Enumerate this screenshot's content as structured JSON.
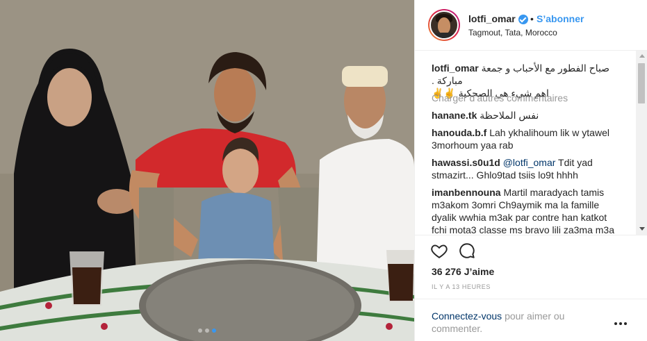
{
  "post": {
    "carousel_dots": 3,
    "active_dot": 2
  },
  "header": {
    "username": "lotfi_omar",
    "separator": "•",
    "follow_label": "S’abonner",
    "location": "Tagmout, Tata, Morocco"
  },
  "caption": {
    "username": "lotfi_omar",
    "text_line1": "صباح الفطور مع الأحباب و جمعة مباركة .",
    "text_line2": "اهم شيء هي الصحكية ✌️✌️"
  },
  "load_more": "Charger d’autres commentaires",
  "comments": [
    {
      "username": "hanane.tk",
      "text": "نفس الملاحظة"
    },
    {
      "username": "hanouda.b.f",
      "text": "Lah ykhalihoum lik w ytawel",
      "text2": "3morhoum yaa rab"
    },
    {
      "username": "hawassi.s0u1d",
      "mention": "@lotfi_omar",
      "text": "Tdit yad",
      "text2": "stmazirt... Ghlo9tad tsiis lo9t hhhh"
    },
    {
      "username": "imanbennouna",
      "text": "Martil maradyach tamis",
      "text2": "m3akom 3omri Ch9aymik ma la famille",
      "text3": "dyalik wwhia m3ak par contre han katkot",
      "text4": "fchi mota3 classe ms bravo lili za3ma m3a"
    }
  ],
  "likes": "36 276 J’aime",
  "timestamp": "IL Y A 13 HEURES",
  "login": {
    "link": "Connectez-vous",
    "text": "pour aimer ou commenter."
  },
  "icons": {
    "like": "heart-icon",
    "comment": "comment-bubble-icon",
    "more": "more-options-icon",
    "verified": "verified-badge-icon"
  },
  "colors": {
    "accent": "#3897f0",
    "text": "#262626",
    "muted": "#999999",
    "link": "#003569"
  }
}
